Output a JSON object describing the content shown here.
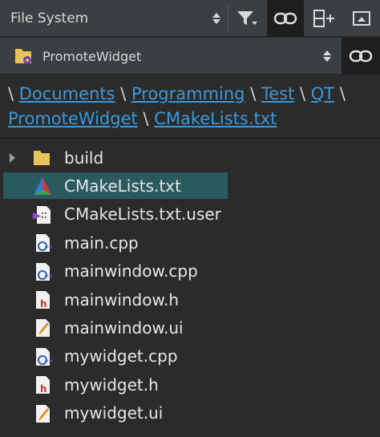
{
  "toolbar": {
    "view_selector": "File System",
    "colors": {
      "bg": "#3c3f41",
      "active_bg": "#1e1e1e"
    }
  },
  "project": {
    "name": "PromoteWidget"
  },
  "breadcrumb": {
    "separator": "\\",
    "parts": [
      "Documents",
      "Programming",
      "Test",
      "QT",
      "PromoteWidget",
      "CMakeLists.txt"
    ]
  },
  "files": [
    {
      "name": "build",
      "icon": "folder-icon",
      "type": "folder"
    },
    {
      "name": "CMakeLists.txt",
      "icon": "cmake-icon",
      "type": "cmake",
      "selected": true
    },
    {
      "name": "CMakeLists.txt.user",
      "icon": "user-file-icon",
      "type": "user"
    },
    {
      "name": "main.cpp",
      "icon": "cpp-file-icon",
      "type": "cpp"
    },
    {
      "name": "mainwindow.cpp",
      "icon": "cpp-file-icon",
      "type": "cpp"
    },
    {
      "name": "mainwindow.h",
      "icon": "header-file-icon",
      "type": "h"
    },
    {
      "name": "mainwindow.ui",
      "icon": "ui-file-icon",
      "type": "ui"
    },
    {
      "name": "mywidget.cpp",
      "icon": "cpp-file-icon",
      "type": "cpp"
    },
    {
      "name": "mywidget.h",
      "icon": "header-file-icon",
      "type": "h"
    },
    {
      "name": "mywidget.ui",
      "icon": "ui-file-icon",
      "type": "ui"
    }
  ],
  "accent": {
    "link": "#3c98d8",
    "selection": "#2a5a60"
  }
}
